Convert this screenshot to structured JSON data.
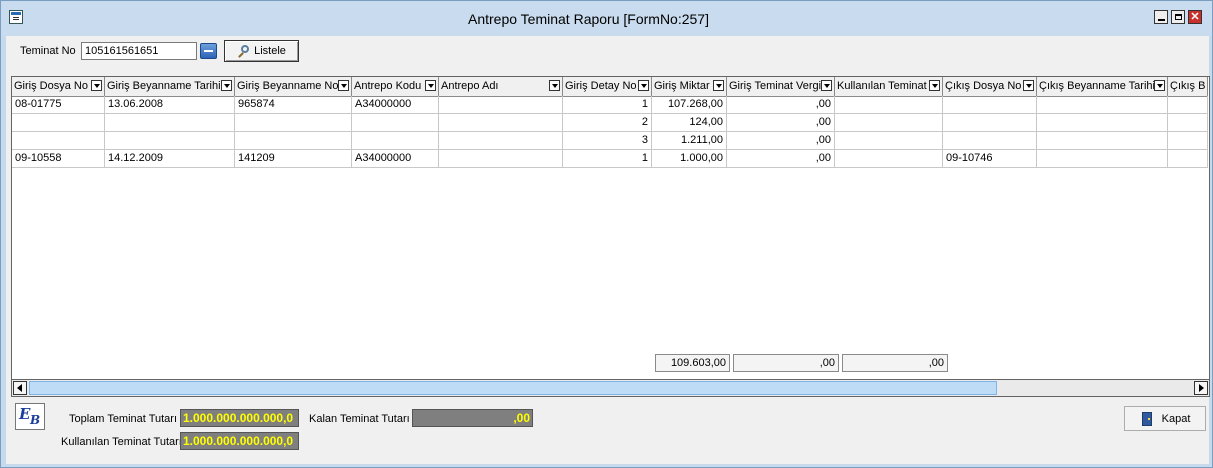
{
  "window": {
    "title": "Antrepo Teminat Raporu [FormNo:257]",
    "close_glyph": "✕"
  },
  "toolbar": {
    "teminat_no_label": "Teminat No",
    "teminat_no_value": "105161561651",
    "listele_label": "Listele"
  },
  "grid": {
    "columns": [
      "Giriş Dosya No",
      "Giriş Beyanname Tarihi",
      "Giriş Beyanname No",
      "Antrepo Kodu",
      "Antrepo Adı",
      "Giriş Detay No",
      "Giriş Miktar",
      "Giriş Teminat Vergi",
      "Kullanılan Teminat",
      "Çıkış Dosya No",
      "Çıkış Beyanname Tarihi",
      "Çıkış B"
    ],
    "rows": [
      [
        "08-01775",
        "13.06.2008",
        "965874",
        "A34000000",
        "",
        "1",
        "107.268,00",
        ",00",
        "",
        "",
        "",
        ""
      ],
      [
        "",
        "",
        "",
        "",
        "",
        "2",
        "124,00",
        ",00",
        "",
        "",
        "",
        ""
      ],
      [
        "",
        "",
        "",
        "",
        "",
        "3",
        "1.211,00",
        ",00",
        "",
        "",
        "",
        ""
      ],
      [
        "09-10558",
        "14.12.2009",
        "141209",
        "A34000000",
        "",
        "1",
        "1.000,00",
        ",00",
        "",
        "09-10746",
        "",
        ""
      ]
    ],
    "totals": {
      "giris_miktar": "109.603,00",
      "giris_teminat_vergi": ",00",
      "kullanilan_teminat": ",00"
    }
  },
  "summary": {
    "toplam_label": "Toplam Teminat Tutarı",
    "toplam_value": "1.000.000.000.000,0",
    "kalan_label": "Kalan Teminat Tutarı",
    "kalan_value": ",00",
    "kullanilan_label": "Kullanılan Teminat Tutarı",
    "kullanilan_value": "1.000.000.000.000,0"
  },
  "logo": {
    "line1": "E",
    "line2": "B"
  },
  "kapat_label": "Kapat",
  "colors": {
    "titlebar": "#c9dbee",
    "amount_bg": "#7f7f7f",
    "amount_text": "#ffff00",
    "scroll_thumb": "#bfdcf7"
  }
}
